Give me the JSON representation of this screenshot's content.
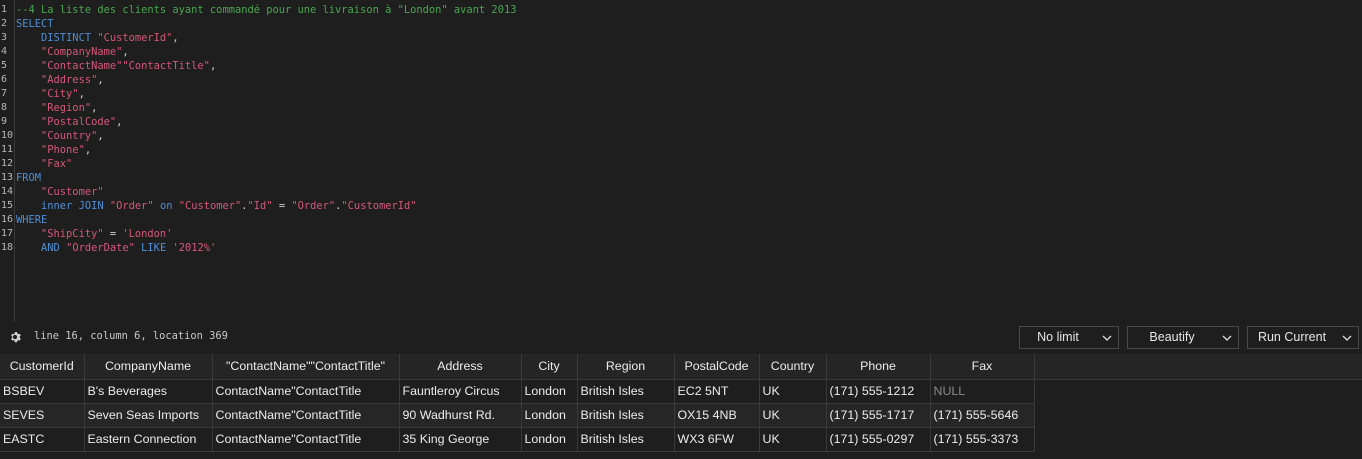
{
  "editor": {
    "line_numbers": [
      "1",
      "2",
      "3",
      "4",
      "5",
      "6",
      "7",
      "8",
      "9",
      "10",
      "11",
      "12",
      "13",
      "14",
      "15",
      "16",
      "17",
      "18"
    ],
    "lines": [
      [
        {
          "t": "--4 La liste des clients ayant commandé pour une livraison à \"London\" avant 2013",
          "c": "t-comment"
        }
      ],
      [
        {
          "t": "SELECT",
          "c": "t-kw"
        }
      ],
      [
        {
          "t": "    ",
          "c": ""
        },
        {
          "t": "DISTINCT",
          "c": "t-kw"
        },
        {
          "t": " ",
          "c": ""
        },
        {
          "t": "\"CustomerId\"",
          "c": "t-str"
        },
        {
          "t": ",",
          "c": "t-punc"
        }
      ],
      [
        {
          "t": "    ",
          "c": ""
        },
        {
          "t": "\"CompanyName\"",
          "c": "t-str"
        },
        {
          "t": ",",
          "c": "t-punc"
        }
      ],
      [
        {
          "t": "    ",
          "c": ""
        },
        {
          "t": "\"ContactName\"\"ContactTitle\"",
          "c": "t-str"
        },
        {
          "t": ",",
          "c": "t-punc"
        }
      ],
      [
        {
          "t": "    ",
          "c": ""
        },
        {
          "t": "\"Address\"",
          "c": "t-str"
        },
        {
          "t": ",",
          "c": "t-punc"
        }
      ],
      [
        {
          "t": "    ",
          "c": ""
        },
        {
          "t": "\"City\"",
          "c": "t-str"
        },
        {
          "t": ",",
          "c": "t-punc"
        }
      ],
      [
        {
          "t": "    ",
          "c": ""
        },
        {
          "t": "\"Region\"",
          "c": "t-str"
        },
        {
          "t": ",",
          "c": "t-punc"
        }
      ],
      [
        {
          "t": "    ",
          "c": ""
        },
        {
          "t": "\"PostalCode\"",
          "c": "t-str"
        },
        {
          "t": ",",
          "c": "t-punc"
        }
      ],
      [
        {
          "t": "    ",
          "c": ""
        },
        {
          "t": "\"Country\"",
          "c": "t-str"
        },
        {
          "t": ",",
          "c": "t-punc"
        }
      ],
      [
        {
          "t": "    ",
          "c": ""
        },
        {
          "t": "\"Phone\"",
          "c": "t-str"
        },
        {
          "t": ",",
          "c": "t-punc"
        }
      ],
      [
        {
          "t": "    ",
          "c": ""
        },
        {
          "t": "\"Fax\"",
          "c": "t-str"
        }
      ],
      [
        {
          "t": "FROM",
          "c": "t-kw"
        }
      ],
      [
        {
          "t": "    ",
          "c": ""
        },
        {
          "t": "\"Customer\"",
          "c": "t-str"
        }
      ],
      [
        {
          "t": "    ",
          "c": ""
        },
        {
          "t": "inner",
          "c": "t-kw"
        },
        {
          "t": " ",
          "c": ""
        },
        {
          "t": "JOIN",
          "c": "t-kw"
        },
        {
          "t": " ",
          "c": ""
        },
        {
          "t": "\"Order\"",
          "c": "t-str"
        },
        {
          "t": " ",
          "c": ""
        },
        {
          "t": "on",
          "c": "t-kw"
        },
        {
          "t": " ",
          "c": ""
        },
        {
          "t": "\"Customer\"",
          "c": "t-str"
        },
        {
          "t": ".",
          "c": "t-punc"
        },
        {
          "t": "\"Id\"",
          "c": "t-str"
        },
        {
          "t": " = ",
          "c": "t-op"
        },
        {
          "t": "\"Order\"",
          "c": "t-str"
        },
        {
          "t": ".",
          "c": "t-punc"
        },
        {
          "t": "\"CustomerId\"",
          "c": "t-str"
        }
      ],
      [
        {
          "t": "WHERE",
          "c": "t-kw"
        }
      ],
      [
        {
          "t": "    ",
          "c": ""
        },
        {
          "t": "\"ShipCity\"",
          "c": "t-str"
        },
        {
          "t": " = ",
          "c": "t-op"
        },
        {
          "t": "'London'",
          "c": "t-sq"
        }
      ],
      [
        {
          "t": "    ",
          "c": ""
        },
        {
          "t": "AND",
          "c": "t-kw"
        },
        {
          "t": " ",
          "c": ""
        },
        {
          "t": "\"OrderDate\"",
          "c": "t-str"
        },
        {
          "t": " ",
          "c": ""
        },
        {
          "t": "LIKE",
          "c": "t-kw"
        },
        {
          "t": " ",
          "c": ""
        },
        {
          "t": "'2012%'",
          "c": "t-sq"
        }
      ]
    ]
  },
  "toolbar": {
    "status": "line 16, column 6, location 369",
    "limit_label": "No limit",
    "beautify_label": "Beautify",
    "run_label": "Run Current"
  },
  "results": {
    "columns": [
      "CustomerId",
      "CompanyName",
      "\"ContactName\"\"ContactTitle\"",
      "Address",
      "City",
      "Region",
      "PostalCode",
      "Country",
      "Phone",
      "Fax"
    ],
    "rows": [
      [
        "BSBEV",
        "B's Beverages",
        "ContactName\"ContactTitle",
        "Fauntleroy Circus",
        "London",
        "British Isles",
        "EC2 5NT",
        "UK",
        "(171) 555-1212",
        "NULL"
      ],
      [
        "SEVES",
        "Seven Seas Imports",
        "ContactName\"ContactTitle",
        "90 Wadhurst Rd.",
        "London",
        "British Isles",
        "OX15 4NB",
        "UK",
        "(171) 555-1717",
        "(171) 555-5646"
      ],
      [
        "EASTC",
        "Eastern Connection",
        "ContactName\"ContactTitle",
        "35 King George",
        "London",
        "British Isles",
        "WX3 6FW",
        "UK",
        "(171) 555-0297",
        "(171) 555-3373"
      ]
    ]
  },
  "colors": {
    "background": "#1e1e1e",
    "keyword": "#4f8fd6",
    "string": "#d6577a",
    "comment": "#4aa64f"
  }
}
